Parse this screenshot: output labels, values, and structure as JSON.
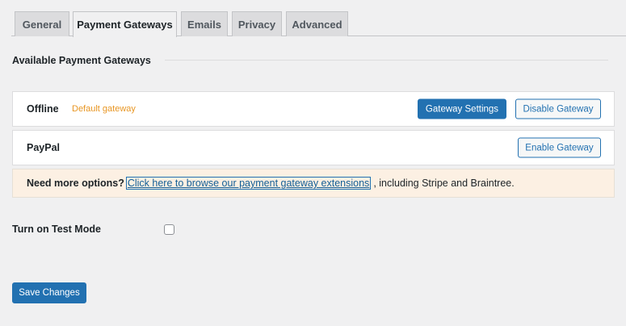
{
  "tabs": [
    {
      "label": "General",
      "active": false
    },
    {
      "label": "Payment Gateways",
      "active": true
    },
    {
      "label": "Emails",
      "active": false
    },
    {
      "label": "Privacy",
      "active": false
    },
    {
      "label": "Advanced",
      "active": false
    }
  ],
  "section": {
    "title": "Available Payment Gateways"
  },
  "gateways": [
    {
      "name": "Offline",
      "badge": "Default gateway",
      "settings_button": "Gateway Settings",
      "toggle_button": "Disable Gateway"
    },
    {
      "name": "PayPal",
      "toggle_button": "Enable Gateway"
    }
  ],
  "notice": {
    "lead": "Need more options?",
    "link_text": "Click here to browse our payment gateway extensions",
    "trail": ", including Stripe and Braintree."
  },
  "test_mode": {
    "label": "Turn on Test Mode",
    "checked": false
  },
  "save_button": "Save Changes",
  "colors": {
    "primary": "#2271b1",
    "badge": "#e89623",
    "notice_bg": "#fcf0e3",
    "page_bg": "#f0f0f1"
  }
}
